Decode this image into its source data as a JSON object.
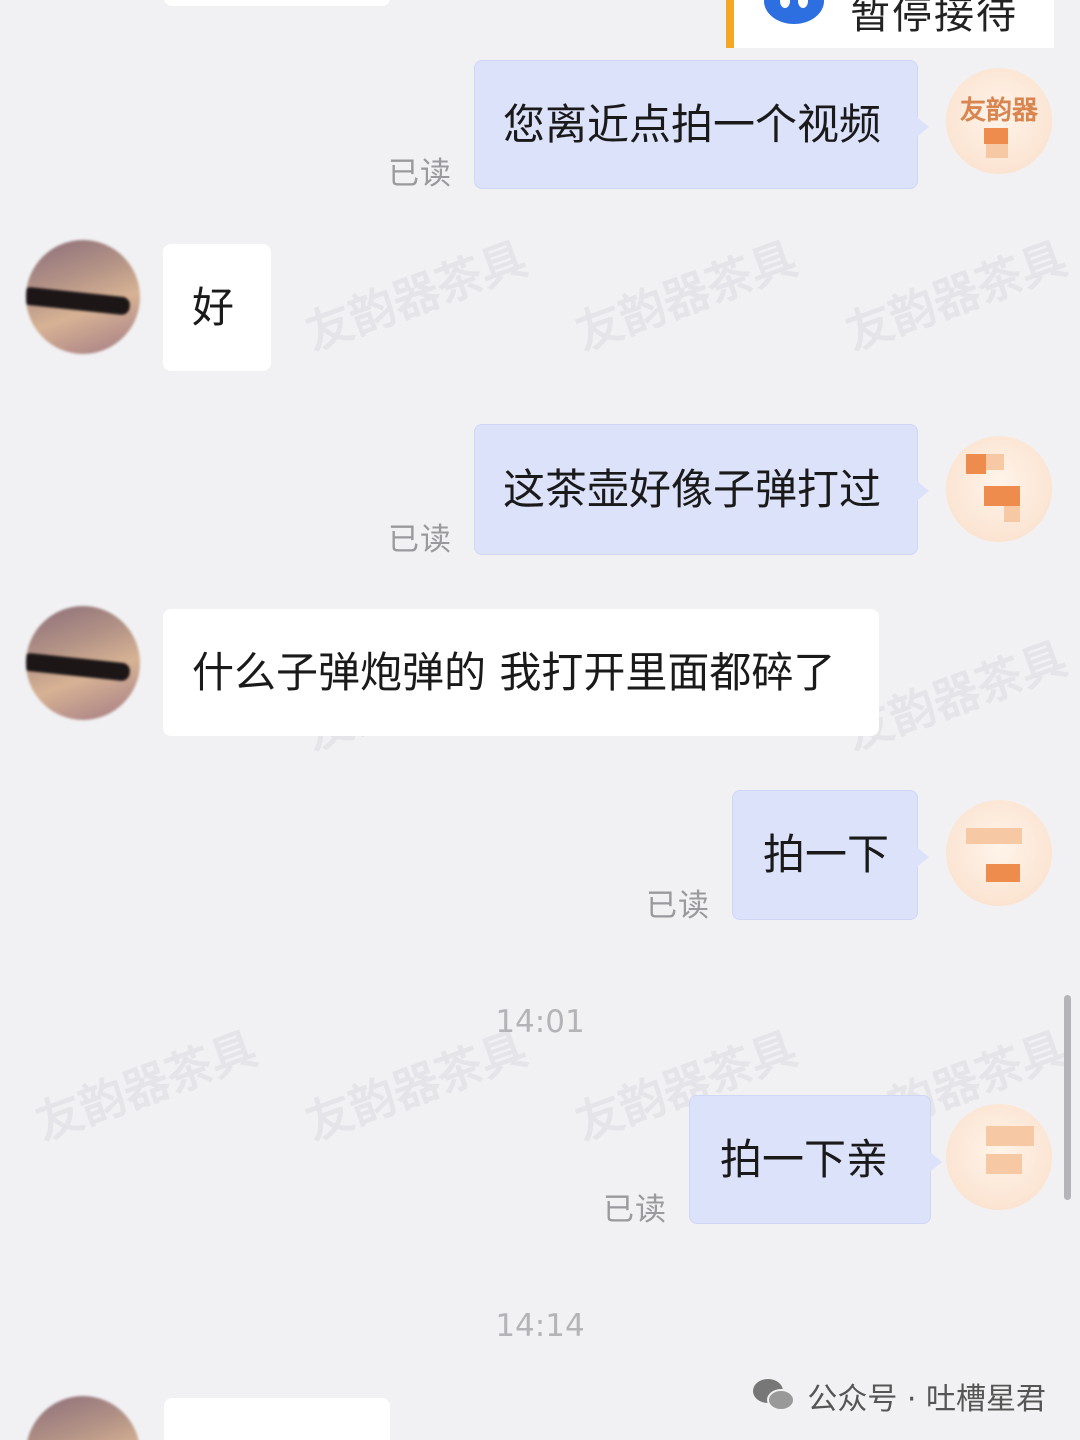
{
  "header": {
    "status_label": "暂停接待"
  },
  "agent_avatar": {
    "logo_text": "友韵器"
  },
  "messages": [
    {
      "sender": "agent",
      "text": "您离近点拍一个视频",
      "read_status": "已读"
    },
    {
      "sender": "customer",
      "text": "好"
    },
    {
      "sender": "agent",
      "text": "这茶壶好像子弹打过",
      "read_status": "已读"
    },
    {
      "sender": "customer",
      "text": "什么子弹炮弹的 我打开里面都碎了"
    },
    {
      "sender": "agent",
      "text": "拍一下",
      "read_status": "已读"
    },
    {
      "sender": "agent",
      "text": "拍一下亲",
      "read_status": "已读"
    }
  ],
  "timestamps": [
    "14:01",
    "14:14"
  ],
  "watermark_text": "友韵器茶具",
  "footer": {
    "account_label": "公众号 · 吐槽星君"
  }
}
